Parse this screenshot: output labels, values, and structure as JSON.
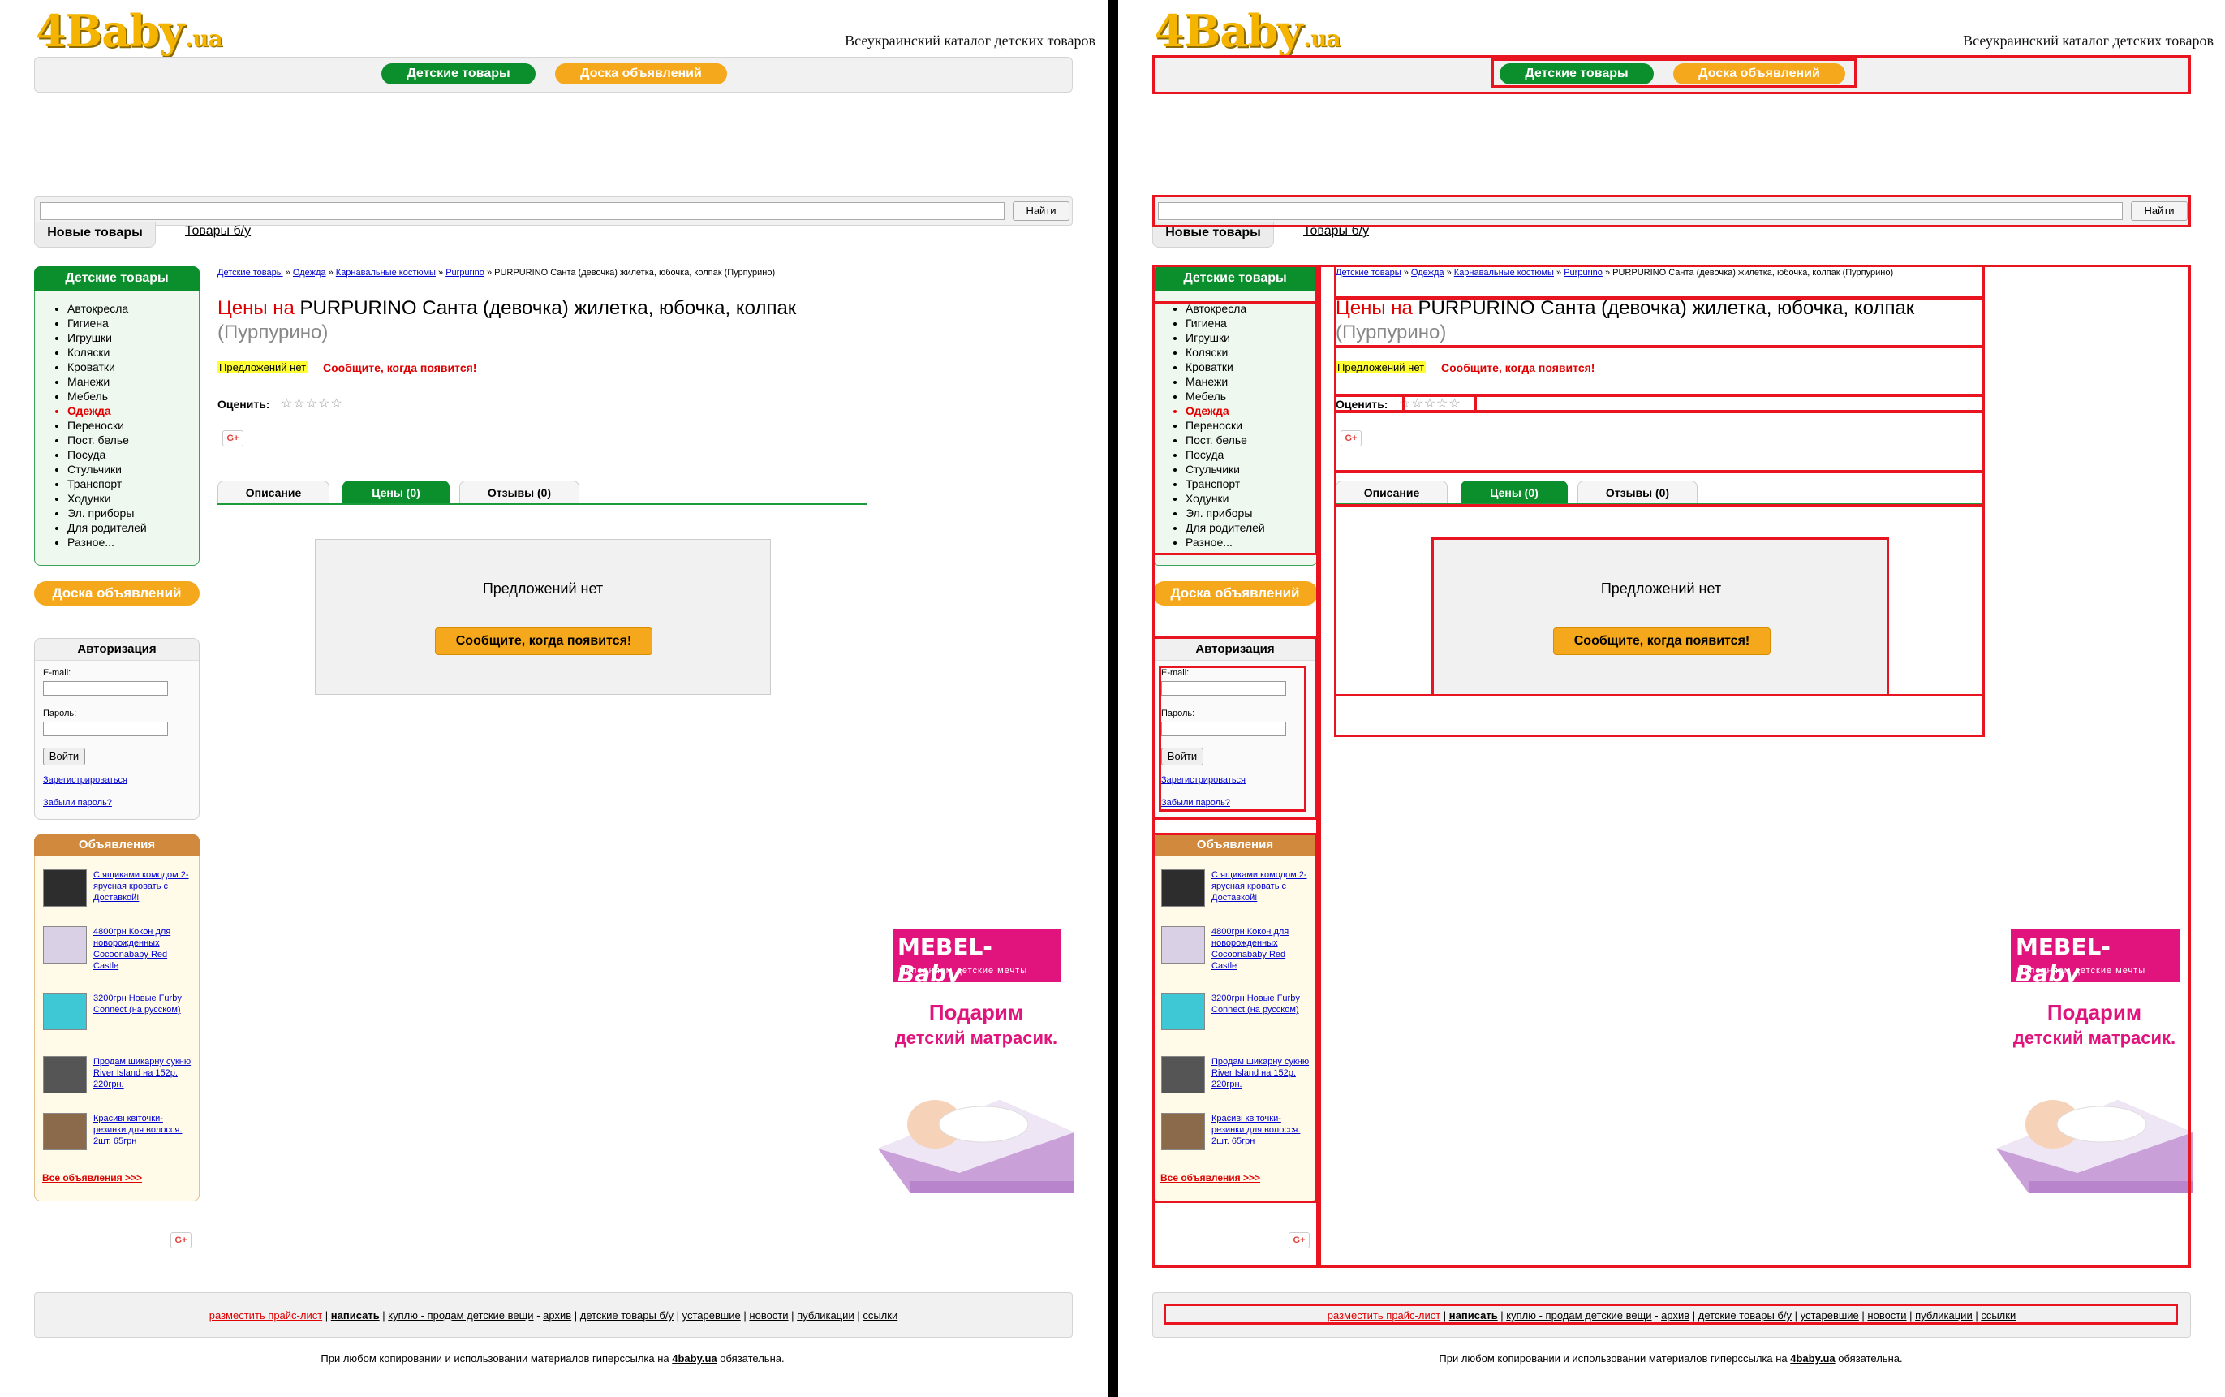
{
  "site": {
    "logo": "4Baby",
    "logo_suffix": ".ua",
    "tagline": "Всеукраинский каталог детских товаров",
    "brand_green": "#0b8f2d",
    "brand_orange": "#f6a81c",
    "debug_outline_color": "#e8141f"
  },
  "nav": {
    "kids_goods": "Детские товары",
    "classifieds": "Доска объявлений"
  },
  "search": {
    "button": "Найти",
    "placeholder": ""
  },
  "catalog_tabs": {
    "new": "Новые товары",
    "used": "Товары б/у"
  },
  "sidebar": {
    "categories_title": "Детские товары",
    "categories": [
      "Автокресла",
      "Гигиена",
      "Игрушки",
      "Коляски",
      "Кроватки",
      "Манежи",
      "Мебель",
      "Одежда",
      "Переноски",
      "Пост. белье",
      "Посуда",
      "Стульчики",
      "Транспорт",
      "Ходунки",
      "Эл. приборы",
      "Для родителей",
      "Разное..."
    ],
    "active_category": "Одежда",
    "board_button": "Доска объявлений",
    "auth": {
      "title": "Авторизация",
      "email_label": "E-mail:",
      "password_label": "Пароль:",
      "login_button": "Войти",
      "register": "Зарегистрироваться",
      "forgot": "Забыли пароль?"
    },
    "ads": {
      "title": "Объявления",
      "items": [
        "С ящиками комодом 2-ярусная кровать с Доставкой!",
        "4800грн Кокон для новорожденных Cocoonababy Red Castle",
        "3200грн Новые Furby Connect (на русском)",
        "Продам шикарну сукню River Island на 152р. 220грн.",
        "Красиві квіточки-резинки для волосся. 2шт. 65грн"
      ],
      "all": "Все объявления >>>"
    },
    "share_button": "G+"
  },
  "breadcrumb": {
    "items": [
      "Детские товары",
      "Одежда",
      "Карнавальные костюмы",
      "Purpurino"
    ],
    "separator": "»",
    "current": "PURPURINO Санта (девочка) жилетка, юбочка, колпак (Пурпурино)"
  },
  "product": {
    "title_prefix": "Цены на",
    "title_main": "PURPURINO Санта (девочка) жилетка, юбочка, колпак",
    "title_suffix": "(Пурпурино)",
    "no_offers": "Предложений нет",
    "notify_link": "Сообщите, когда появится!",
    "rate_label": "Оценить:",
    "stars": "☆☆☆☆☆",
    "rating_value": 0,
    "share_button": "G+"
  },
  "product_tabs": {
    "description": "Описание",
    "prices": "Цены (0)",
    "reviews": "Отзывы (0)"
  },
  "offers_panel": {
    "text": "Предложений нет",
    "button": "Сообщите, когда появится!"
  },
  "banner": {
    "brand": "MEBEL-",
    "brand_script": "Baby",
    "slogan": "Исполняем детские мечты",
    "line1": "Подарим",
    "line2": "детский матрасик."
  },
  "footer": {
    "links": [
      "разместить прайс-лист",
      "написать",
      "куплю - продам детские вещи",
      "архив",
      "детские товары б/у",
      "устаревшие",
      "новости",
      "публикации",
      "ссылки"
    ],
    "copyright_prefix": "При любом копировании и использовании материалов гиперссылка на",
    "copyright_site": "4baby.ua",
    "copyright_suffix": "обязательна."
  }
}
